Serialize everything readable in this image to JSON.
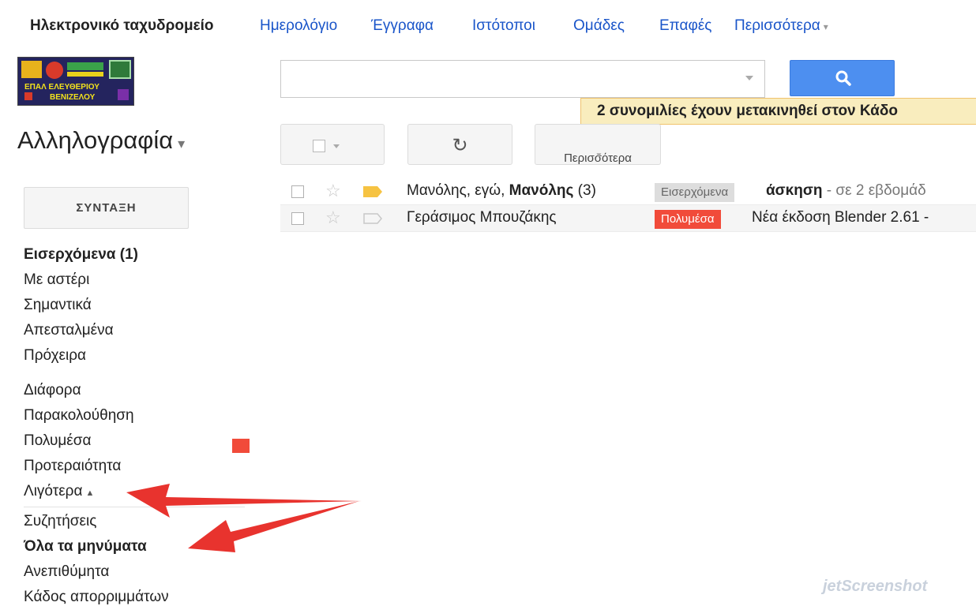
{
  "topnav": {
    "mail": "Ηλεκτρονικό ταχυδρομείο",
    "calendar": "Ημερολόγιο",
    "documents": "Έγγραφα",
    "sites": "Ιστότοποι",
    "groups": "Ομάδες",
    "contacts": "Επαφές",
    "more": "Περισσότερα"
  },
  "search": {
    "value": "",
    "button_icon": "search-icon"
  },
  "notice": "2 συνομιλίες έχουν μετακινηθεί στον Κάδο",
  "mail_title": "Αλληλογραφία",
  "toolbar": {
    "refresh_icon": "↻",
    "more_label": "Περισσότερα"
  },
  "compose_label": "ΣΥΝΤΑΞΗ",
  "sidebar": {
    "inbox": "Εισερχόμενα (1)",
    "starred": "Με αστέρι",
    "important": "Σημαντικά",
    "sent": "Απεσταλμένα",
    "drafts": "Πρόχειρα",
    "misc": "Διάφορα",
    "followup": "Παρακολούθηση",
    "multimedia": "Πολυμέσα",
    "priority": "Προτεραιότητα",
    "less": "Λιγότερα",
    "chats": "Συζητήσεις",
    "all_mail": "Όλα τα μηνύματα",
    "spam": "Ανεπιθύμητα",
    "trash": "Κάδος απορριμμάτων"
  },
  "messages": [
    {
      "sender_plain": "Μανόλης, εγώ, ",
      "sender_bold": "Μανόλης",
      "sender_count": " (3)",
      "label": "Εισερχόμενα",
      "subject": "άσκηση",
      "snippet": " - σε 2 εβδομάδ"
    },
    {
      "sender_plain": "Γεράσιμος Μπουζάκης",
      "label": "Πολυμέσα",
      "subject": "Νέα έκδοση Blender 2.61 -"
    }
  ],
  "colors": {
    "link": "#1a55c9",
    "search_button": "#4d8ff0",
    "notice_bg": "#f9edbe",
    "label_multimedia": "#f14b3a",
    "important_marker": "#f6c342",
    "arrow": "#e8332e"
  },
  "logo_text": "ΕΠΑΛ ΕΛΕΥΘΕΡΙΟΥ ΒΕΝΙΖΕΛΟΥ",
  "watermark": "jetScreenshot"
}
